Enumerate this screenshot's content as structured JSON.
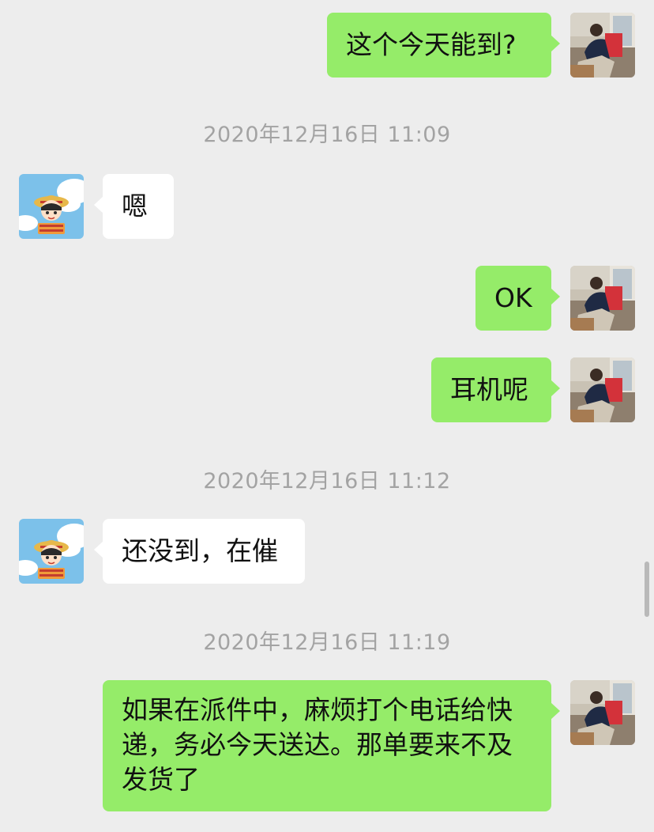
{
  "messages": [
    {
      "type": "message",
      "sender": "me",
      "text": "这个今天能到?",
      "avatar": "photo-avatar"
    },
    {
      "type": "timestamp",
      "text": "2020年12月16日 11:09"
    },
    {
      "type": "message",
      "sender": "other",
      "text": "嗯",
      "avatar": "cartoon-girl-avatar"
    },
    {
      "type": "message",
      "sender": "me",
      "text": "OK",
      "avatar": "photo-avatar"
    },
    {
      "type": "message",
      "sender": "me",
      "text": "耳机呢",
      "avatar": "photo-avatar"
    },
    {
      "type": "timestamp",
      "text": "2020年12月16日 11:12"
    },
    {
      "type": "message",
      "sender": "other",
      "text": "还没到，在催",
      "avatar": "cartoon-girl-avatar"
    },
    {
      "type": "timestamp",
      "text": "2020年12月16日 11:19"
    },
    {
      "type": "message",
      "sender": "me",
      "text": "如果在派件中，麻烦打个电话给快递，务必今天送达。那单要来不及发货了",
      "avatar": "photo-avatar"
    }
  ],
  "colors": {
    "background": "#ededed",
    "my_bubble": "#95ec69",
    "other_bubble": "#ffffff",
    "timestamp_text": "#a3a3a3"
  }
}
